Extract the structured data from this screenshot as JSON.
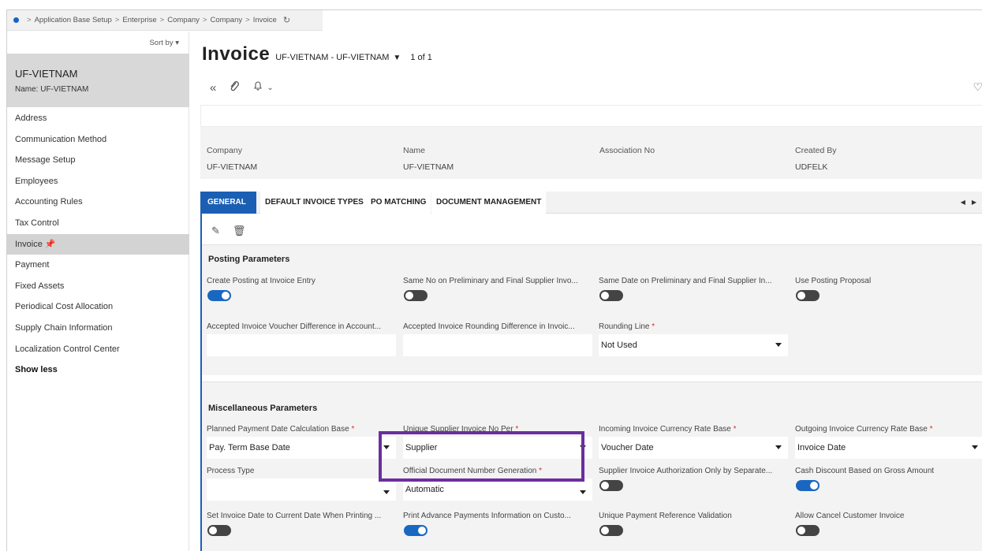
{
  "breadcrumb": {
    "items": [
      "Application Base Setup",
      "Enterprise",
      "Company",
      "Company",
      "Invoice"
    ],
    "separator": ">",
    "refresh_icon": "↻"
  },
  "sidebar": {
    "sort_label": "Sort by",
    "record_title": "UF-VIETNAM",
    "record_subtitle": "Name:  UF-VIETNAM",
    "items": [
      {
        "label": "Address"
      },
      {
        "label": "Communication Method"
      },
      {
        "label": "Message Setup"
      },
      {
        "label": "Employees"
      },
      {
        "label": "Accounting Rules"
      },
      {
        "label": "Tax Control"
      },
      {
        "label": "Invoice 📌",
        "active": true
      },
      {
        "label": "Payment"
      },
      {
        "label": "Fixed Assets"
      },
      {
        "label": "Periodical Cost Allocation"
      },
      {
        "label": "Supply Chain Information"
      },
      {
        "label": "Localization Control Center"
      },
      {
        "label": "Show less"
      }
    ]
  },
  "page": {
    "title": "Invoice",
    "record_selector": "UF-VIETNAM - UF-VIETNAM",
    "pager": "1 of 1"
  },
  "header": {
    "company_label": "Company",
    "company_value": "UF-VIETNAM",
    "name_label": "Name",
    "name_value": "UF-VIETNAM",
    "association_label": "Association No",
    "association_value": "",
    "created_by_label": "Created By",
    "created_by_value": "UDFELK"
  },
  "tabs": [
    "GENERAL",
    "DEFAULT INVOICE TYPES",
    "PO MATCHING",
    "DOCUMENT MANAGEMENT"
  ],
  "posting": {
    "title": "Posting Parameters",
    "create_posting_label": "Create Posting at Invoice Entry",
    "same_no_label": "Same No on Preliminary and Final Supplier Invo...",
    "same_date_label": "Same Date on Preliminary and Final Supplier In...",
    "use_proposal_label": "Use Posting Proposal",
    "voucher_diff_label": "Accepted Invoice Voucher Difference in Account...",
    "rounding_diff_label": "Accepted Invoice Rounding Difference in Invoic...",
    "rounding_line_label": "Rounding Line",
    "rounding_line_value": "Not Used",
    "required_mark": "*"
  },
  "misc": {
    "title": "Miscellaneous Parameters",
    "planned_payment_label": "Planned Payment Date Calculation Base",
    "planned_payment_value": "Pay. Term Base Date",
    "unique_supplier_label": "Unique Supplier Invoice No Per",
    "unique_supplier_value": "Supplier",
    "incoming_rate_label": "Incoming Invoice Currency Rate Base",
    "incoming_rate_value": "Voucher Date",
    "outgoing_rate_label": "Outgoing Invoice Currency Rate Base",
    "outgoing_rate_value": "Invoice Date",
    "process_type_label": "Process Type",
    "process_type_value": "",
    "official_doc_label": "Official Document Number Generation",
    "official_doc_value": "Automatic",
    "supplier_auth_label": "Supplier Invoice Authorization Only by Separate...",
    "cash_discount_label": "Cash Discount Based on Gross Amount",
    "set_invoice_date_label": "Set Invoice Date to Current Date When Printing ...",
    "print_advance_label": "Print Advance Payments Information on Custo...",
    "unique_payment_ref_label": "Unique Payment Reference Validation",
    "allow_cancel_label": "Allow Cancel Customer Invoice"
  },
  "toggle_states": {
    "create_posting": true,
    "same_no": false,
    "same_date": false,
    "use_proposal": false,
    "supplier_auth": false,
    "cash_discount": true,
    "set_invoice_date": false,
    "print_advance": true,
    "unique_payment_ref": false,
    "allow_cancel": false
  },
  "colors": {
    "accent": "#1a5fb4",
    "highlight_box": "#6a2f9e",
    "required": "#d32f2f"
  }
}
